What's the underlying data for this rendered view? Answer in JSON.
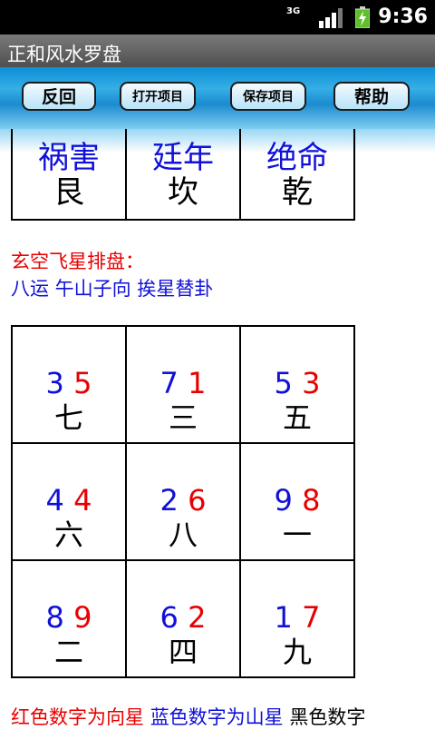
{
  "status": {
    "network": "3G",
    "time": "9:36"
  },
  "app": {
    "title": "正和风水罗盘"
  },
  "toolbar": {
    "back": "反回",
    "open": "打开项目",
    "save": "保存项目",
    "help": "帮助"
  },
  "palaces": [
    {
      "name": "祸害",
      "trigram": "艮"
    },
    {
      "name": "廷年",
      "trigram": "坎"
    },
    {
      "name": "绝命",
      "trigram": "乾"
    }
  ],
  "chart": {
    "heading": "玄空飞星排盘：",
    "subheading": "八运 午山子向 挨星替卦",
    "cells": [
      {
        "mountain": "3",
        "facing": "5",
        "time": "七"
      },
      {
        "mountain": "7",
        "facing": "1",
        "time": "三"
      },
      {
        "mountain": "5",
        "facing": "3",
        "time": "五"
      },
      {
        "mountain": "4",
        "facing": "4",
        "time": "六"
      },
      {
        "mountain": "2",
        "facing": "6",
        "time": "八"
      },
      {
        "mountain": "9",
        "facing": "8",
        "time": "一"
      },
      {
        "mountain": "8",
        "facing": "9",
        "time": "二"
      },
      {
        "mountain": "6",
        "facing": "2",
        "time": "四"
      },
      {
        "mountain": "1",
        "facing": "7",
        "time": "九"
      }
    ]
  },
  "legend": {
    "red_note": "红色数字为向星",
    "blue_note": "蓝色数字为山星",
    "black_note": "黑色数字"
  },
  "colors": {
    "mountain_star": "#1010d8",
    "facing_star": "#e80000",
    "toolbar": "#1b8cd0"
  }
}
